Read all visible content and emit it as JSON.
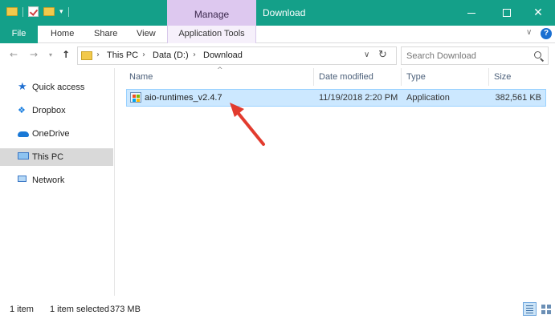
{
  "window": {
    "title": "Download",
    "contextual_tab_group": "Manage",
    "accent_color": "#14a089",
    "contextual_color": "#ddc8ef"
  },
  "ribbon": {
    "tabs": [
      {
        "label": "File"
      },
      {
        "label": "Home"
      },
      {
        "label": "Share"
      },
      {
        "label": "View"
      },
      {
        "label": "Application Tools"
      }
    ]
  },
  "address_bar": {
    "breadcrumbs": [
      "This PC",
      "Data (D:)",
      "Download"
    ],
    "search_placeholder": "Search Download"
  },
  "nav_pane": {
    "items": [
      {
        "label": "Quick access",
        "icon": "star-icon"
      },
      {
        "label": "Dropbox",
        "icon": "dropbox-icon"
      },
      {
        "label": "OneDrive",
        "icon": "cloud-icon"
      },
      {
        "label": "This PC",
        "icon": "computer-icon",
        "selected": true
      },
      {
        "label": "Network",
        "icon": "network-icon"
      }
    ]
  },
  "file_list": {
    "columns": [
      "Name",
      "Date modified",
      "Type",
      "Size"
    ],
    "rows": [
      {
        "name": "aio-runtimes_v2.4.7",
        "date_modified": "11/19/2018 2:20 PM",
        "type": "Application",
        "size": "382,561 KB",
        "selected": true
      }
    ],
    "highlight_arrow_color": "#e23b2e"
  },
  "status_bar": {
    "item_count": "1 item",
    "selection": "1 item selected",
    "selection_size": "373 MB"
  }
}
